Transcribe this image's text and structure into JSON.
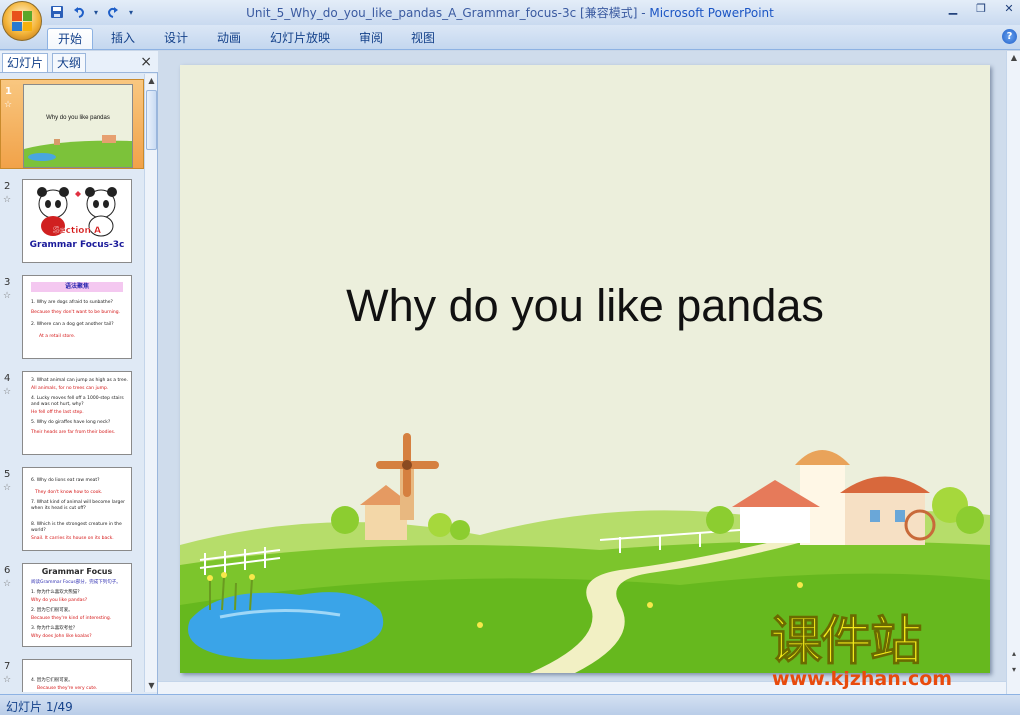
{
  "window": {
    "title_prefix": "Unit_5_Why_do_you_like_pandas_A_Grammar_focus-3c [兼容模式] - ",
    "title_app": "Microsoft PowerPoint"
  },
  "qat": {
    "save_icon": "save-icon",
    "undo_icon": "undo-icon",
    "redo_icon": "redo-icon",
    "more_icon": "dropdown-icon"
  },
  "ribbon": {
    "tabs": [
      "开始",
      "插入",
      "设计",
      "动画",
      "幻灯片放映",
      "审阅",
      "视图"
    ],
    "active": "开始",
    "help": "?"
  },
  "panel": {
    "tab_slides": "幻灯片",
    "tab_outline": "大纲",
    "close": "×"
  },
  "thumbnails": [
    {
      "num": "1",
      "star": "☆",
      "title": "Why do you like pandas"
    },
    {
      "num": "2",
      "star": "☆",
      "line1": "Section A",
      "line2": "Grammar Focus-3c"
    },
    {
      "num": "3",
      "star": "☆",
      "header": "语法聚焦",
      "lines": [
        "1. Why are dogs afraid to sunbathe?",
        "Because they don't want to be burning.",
        "2. Where can a dog get another tail?",
        "At a retail store."
      ]
    },
    {
      "num": "4",
      "star": "☆",
      "lines": [
        "3. What animal can jump as high as a tree.",
        "All animals, for no trees can jump.",
        "4. Lucky moves fell off a 1000-step stairs",
        "and was not hurt, why?",
        "He fell off the last step.",
        "5. Why do giraffes have long neck?",
        "Their heads are far from their bodies."
      ]
    },
    {
      "num": "5",
      "star": "☆",
      "lines": [
        "6. Why do lions eat raw meat?",
        "They don't know how to cook.",
        "7. What kind of animal will become larger",
        "when its head is cut off?",
        "8. Which is the strongest creature in the",
        "world?",
        "Snail. It carries its house on its back."
      ]
    },
    {
      "num": "6",
      "star": "☆",
      "header": "Grammar Focus",
      "lines": [
        "阅读Grammar Focus部分，完成下列句子。",
        "1. 你为什么喜欢大熊猫？",
        "Why do you like pandas?",
        "2. 因为它们很可爱。",
        "Because they're kind of interesting.",
        "3. 你为什么喜欢考拉？",
        "Why does John like koalas?"
      ]
    },
    {
      "num": "7",
      "star": "☆",
      "lines": [
        "4. 因为它们很可爱。",
        "Because they're very cute."
      ]
    }
  ],
  "slide": {
    "title": "Why do you like pandas"
  },
  "status": {
    "text": "幻灯片 1/49"
  },
  "watermark": {
    "big": "课件站",
    "url": "www.kjzhan.com"
  }
}
